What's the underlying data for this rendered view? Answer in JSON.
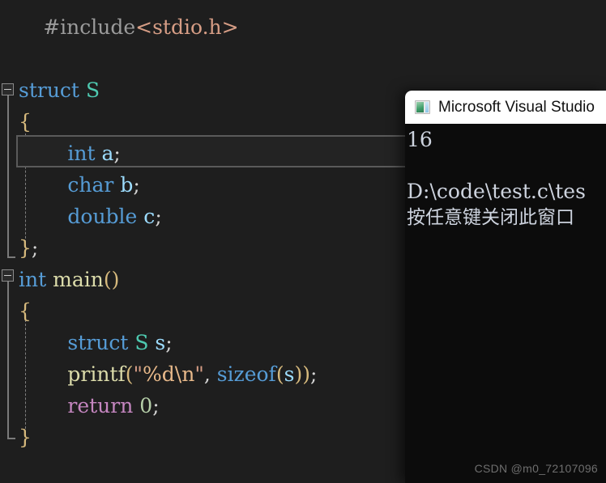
{
  "editor": {
    "background": "#1e1e1e",
    "current_line": "int a;",
    "lines": [
      {
        "indent": 1,
        "segments": [
          {
            "t": "#include",
            "c": "pp"
          },
          {
            "t": "<stdio.h>",
            "c": "hdr"
          }
        ]
      },
      {
        "indent": 0,
        "segments": []
      },
      {
        "indent": 0,
        "fold": "open",
        "segments": [
          {
            "t": "struct",
            "c": "kw"
          },
          {
            "t": " ",
            "c": "pun"
          },
          {
            "t": "S",
            "c": "type"
          }
        ]
      },
      {
        "indent": 0,
        "segments": [
          {
            "t": "{",
            "c": "brcY"
          }
        ]
      },
      {
        "indent": 2,
        "segments": [
          {
            "t": "int",
            "c": "kw"
          },
          {
            "t": " ",
            "c": "pun"
          },
          {
            "t": "a",
            "c": "id"
          },
          {
            "t": ";",
            "c": "pun"
          }
        ]
      },
      {
        "indent": 2,
        "segments": [
          {
            "t": "char",
            "c": "kw"
          },
          {
            "t": " ",
            "c": "pun"
          },
          {
            "t": "b",
            "c": "id"
          },
          {
            "t": ";",
            "c": "pun"
          }
        ]
      },
      {
        "indent": 2,
        "segments": [
          {
            "t": "double",
            "c": "kw"
          },
          {
            "t": " ",
            "c": "pun"
          },
          {
            "t": "c",
            "c": "id"
          },
          {
            "t": ";",
            "c": "pun"
          }
        ]
      },
      {
        "indent": 0,
        "segments": [
          {
            "t": "}",
            "c": "brcY"
          },
          {
            "t": ";",
            "c": "pun"
          }
        ]
      },
      {
        "indent": 0,
        "fold": "open",
        "segments": [
          {
            "t": "int",
            "c": "kw"
          },
          {
            "t": " ",
            "c": "pun"
          },
          {
            "t": "main",
            "c": "fn"
          },
          {
            "t": "()",
            "c": "paren"
          }
        ]
      },
      {
        "indent": 0,
        "segments": [
          {
            "t": "{",
            "c": "brcY"
          }
        ]
      },
      {
        "indent": 2,
        "segments": [
          {
            "t": "struct",
            "c": "kw"
          },
          {
            "t": " ",
            "c": "pun"
          },
          {
            "t": "S",
            "c": "type"
          },
          {
            "t": " ",
            "c": "pun"
          },
          {
            "t": "s",
            "c": "id"
          },
          {
            "t": ";",
            "c": "pun"
          }
        ]
      },
      {
        "indent": 2,
        "segments": [
          {
            "t": "printf",
            "c": "fn"
          },
          {
            "t": "(",
            "c": "paren"
          },
          {
            "t": "\"",
            "c": "str"
          },
          {
            "t": "%d\\n",
            "c": "esc"
          },
          {
            "t": "\"",
            "c": "str"
          },
          {
            "t": ", ",
            "c": "pun"
          },
          {
            "t": "sizeof",
            "c": "kw"
          },
          {
            "t": "(",
            "c": "paren"
          },
          {
            "t": "s",
            "c": "id"
          },
          {
            "t": "))",
            "c": "paren"
          },
          {
            "t": ";",
            "c": "pun"
          }
        ]
      },
      {
        "indent": 2,
        "segments": [
          {
            "t": "return",
            "c": "ret"
          },
          {
            "t": " ",
            "c": "pun"
          },
          {
            "t": "0",
            "c": "num"
          },
          {
            "t": ";",
            "c": "pun"
          }
        ]
      },
      {
        "indent": 0,
        "segments": [
          {
            "t": "}",
            "c": "brcY"
          }
        ]
      }
    ]
  },
  "console": {
    "title": "Microsoft Visual Studio ",
    "icon": "visual-studio-icon",
    "output_lines": [
      "16",
      "",
      "D:\\code\\test.c\\tes",
      "按任意键关闭此窗口"
    ]
  },
  "watermark": {
    "text": "CSDN @m0_72107096"
  }
}
